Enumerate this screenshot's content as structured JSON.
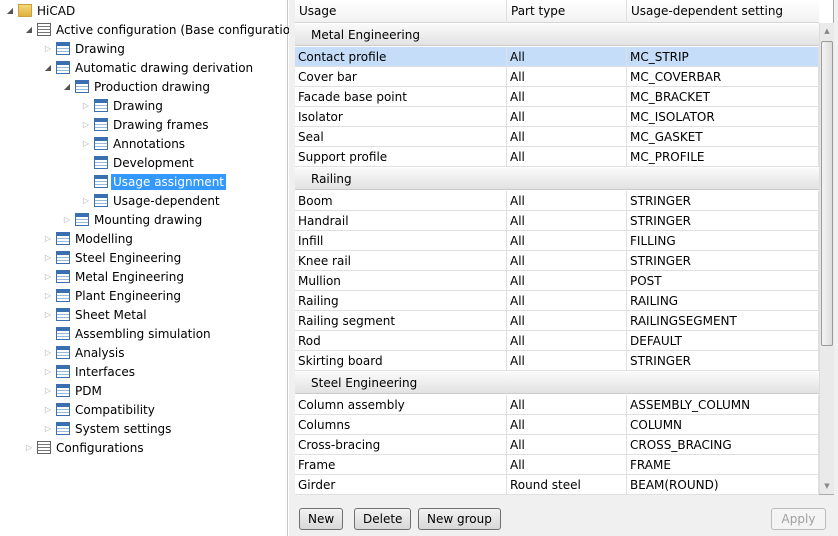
{
  "tree": [
    {
      "label": "HiCAD",
      "level": 0,
      "exp": "open",
      "icon": "root"
    },
    {
      "label": "Active configuration (Base configuration)",
      "level": 1,
      "exp": "open",
      "icon": "list"
    },
    {
      "label": "Drawing",
      "level": 2,
      "exp": "closed"
    },
    {
      "label": "Automatic drawing derivation",
      "level": 2,
      "exp": "open"
    },
    {
      "label": "Production drawing",
      "level": 3,
      "exp": "open"
    },
    {
      "label": "Drawing",
      "level": 4,
      "exp": "closed"
    },
    {
      "label": "Drawing frames",
      "level": 4,
      "exp": "closed"
    },
    {
      "label": "Annotations",
      "level": 4,
      "exp": "closed"
    },
    {
      "label": "Development",
      "level": 4,
      "exp": "none"
    },
    {
      "label": "Usage assignment",
      "level": 4,
      "exp": "none",
      "selected": true
    },
    {
      "label": "Usage-dependent",
      "level": 4,
      "exp": "closed"
    },
    {
      "label": "Mounting drawing",
      "level": 3,
      "exp": "closed"
    },
    {
      "label": "Modelling",
      "level": 2,
      "exp": "closed"
    },
    {
      "label": "Steel Engineering",
      "level": 2,
      "exp": "closed"
    },
    {
      "label": "Metal Engineering",
      "level": 2,
      "exp": "closed"
    },
    {
      "label": "Plant Engineering",
      "level": 2,
      "exp": "closed"
    },
    {
      "label": "Sheet Metal",
      "level": 2,
      "exp": "closed"
    },
    {
      "label": "Assembling simulation",
      "level": 2,
      "exp": "none"
    },
    {
      "label": "Analysis",
      "level": 2,
      "exp": "closed"
    },
    {
      "label": "Interfaces",
      "level": 2,
      "exp": "closed"
    },
    {
      "label": "PDM",
      "level": 2,
      "exp": "closed"
    },
    {
      "label": "Compatibility",
      "level": 2,
      "exp": "closed"
    },
    {
      "label": "System settings",
      "level": 2,
      "exp": "closed"
    },
    {
      "label": "Configurations",
      "level": 1,
      "exp": "closed",
      "icon": "list"
    }
  ],
  "table": {
    "columns": [
      "Usage",
      "Part type",
      "Usage-dependent setting"
    ],
    "groups": [
      {
        "name": "Metal Engineering",
        "rows": [
          [
            "Contact profile",
            "All",
            "MC_STRIP"
          ],
          [
            "Cover bar",
            "All",
            "MC_COVERBAR"
          ],
          [
            "Facade base point",
            "All",
            "MC_BRACKET"
          ],
          [
            "Isolator",
            "All",
            "MC_ISOLATOR"
          ],
          [
            "Seal",
            "All",
            "MC_GASKET"
          ],
          [
            "Support profile",
            "All",
            "MC_PROFILE"
          ]
        ]
      },
      {
        "name": "Railing",
        "rows": [
          [
            "Boom",
            "All",
            "STRINGER"
          ],
          [
            "Handrail",
            "All",
            "STRINGER"
          ],
          [
            "Infill",
            "All",
            "FILLING"
          ],
          [
            "Knee rail",
            "All",
            "STRINGER"
          ],
          [
            "Mullion",
            "All",
            "POST"
          ],
          [
            "Railing",
            "All",
            "RAILING"
          ],
          [
            "Railing segment",
            "All",
            "RAILINGSEGMENT"
          ],
          [
            "Rod",
            "All",
            "DEFAULT"
          ],
          [
            "Skirting board",
            "All",
            "STRINGER"
          ]
        ]
      },
      {
        "name": "Steel Engineering",
        "rows": [
          [
            "Column assembly",
            "All",
            "ASSEMBLY_COLUMN"
          ],
          [
            "Columns",
            "All",
            "COLUMN"
          ],
          [
            "Cross-bracing",
            "All",
            "CROSS_BRACING"
          ],
          [
            "Frame",
            "All",
            "FRAME"
          ],
          [
            "Girder",
            "Round steel",
            "BEAM(ROUND)"
          ]
        ]
      }
    ],
    "selected_row": "Contact profile"
  },
  "buttons": {
    "new": "New",
    "delete": "Delete",
    "new_group": "New group",
    "apply": "Apply"
  }
}
